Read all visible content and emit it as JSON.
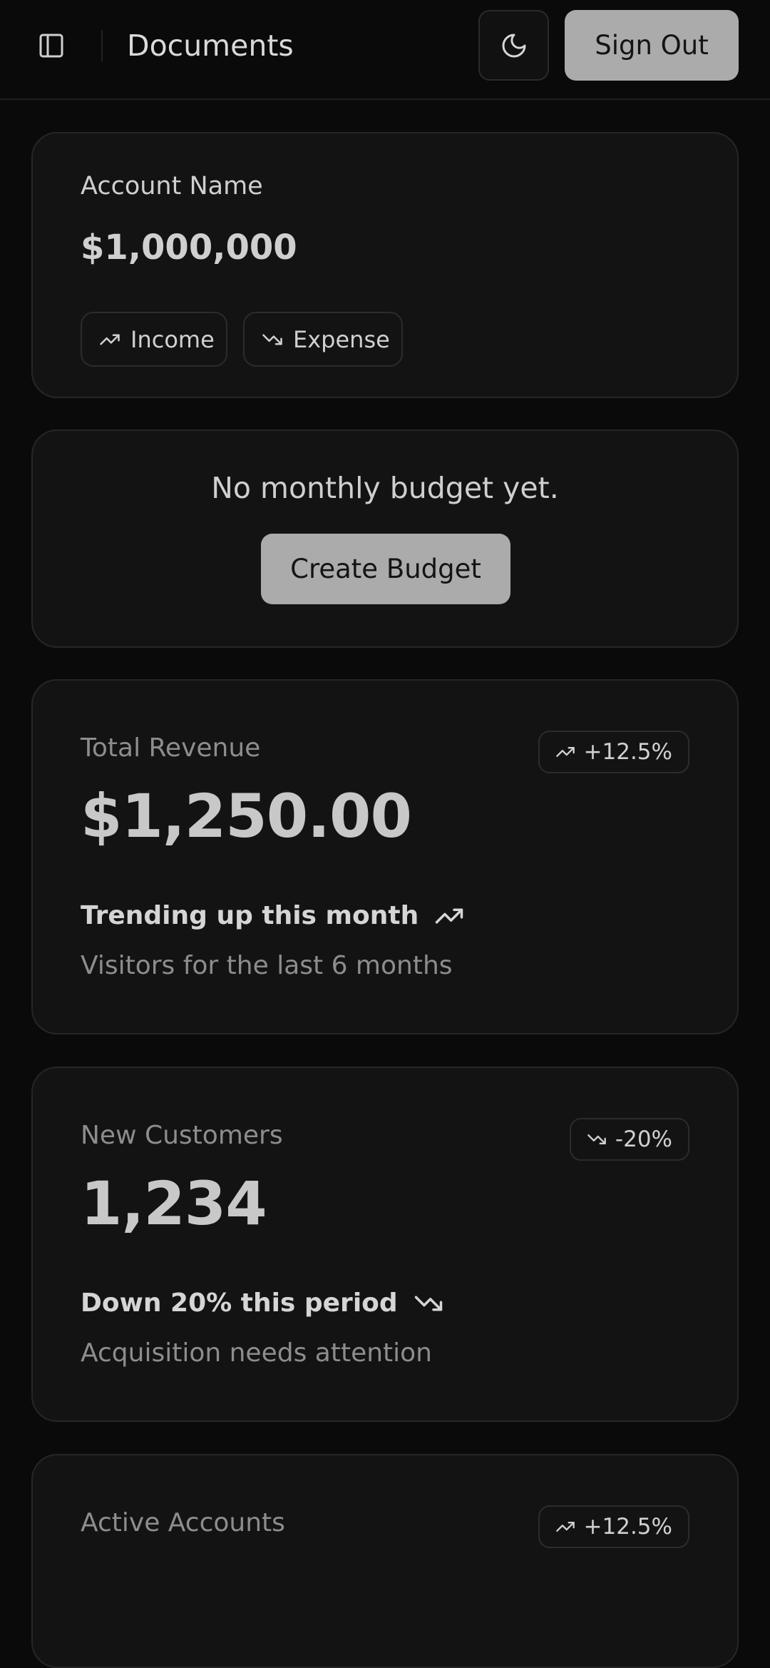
{
  "header": {
    "title": "Documents",
    "sign_out_label": "Sign Out"
  },
  "account": {
    "name": "Account Name",
    "balance": "$1,000,000",
    "income_label": "Income",
    "expense_label": "Expense"
  },
  "budget": {
    "empty_text": "No monthly budget yet.",
    "create_label": "Create Budget"
  },
  "metrics": [
    {
      "label": "Total Revenue",
      "value": "$1,250.00",
      "badge": "+12.5%",
      "direction": "up",
      "trend": "Trending up this month",
      "description": "Visitors for the last 6 months"
    },
    {
      "label": "New Customers",
      "value": "1,234",
      "badge": "-20%",
      "direction": "down",
      "trend": "Down 20% this period",
      "description": "Acquisition needs attention"
    },
    {
      "label": "Active Accounts",
      "badge": "+12.5%",
      "direction": "up"
    }
  ],
  "colors": {
    "background": "#0a0a0a",
    "card": "#131313",
    "card_border": "#262626",
    "button_fill": "#ababab",
    "text_primary": "#d0d0d0",
    "text_muted": "#8d8d8d"
  },
  "icons": {
    "sidebar": "sidebar-panel-icon",
    "theme": "moon-icon",
    "up": "trending-up-icon",
    "down": "trending-down-icon"
  }
}
